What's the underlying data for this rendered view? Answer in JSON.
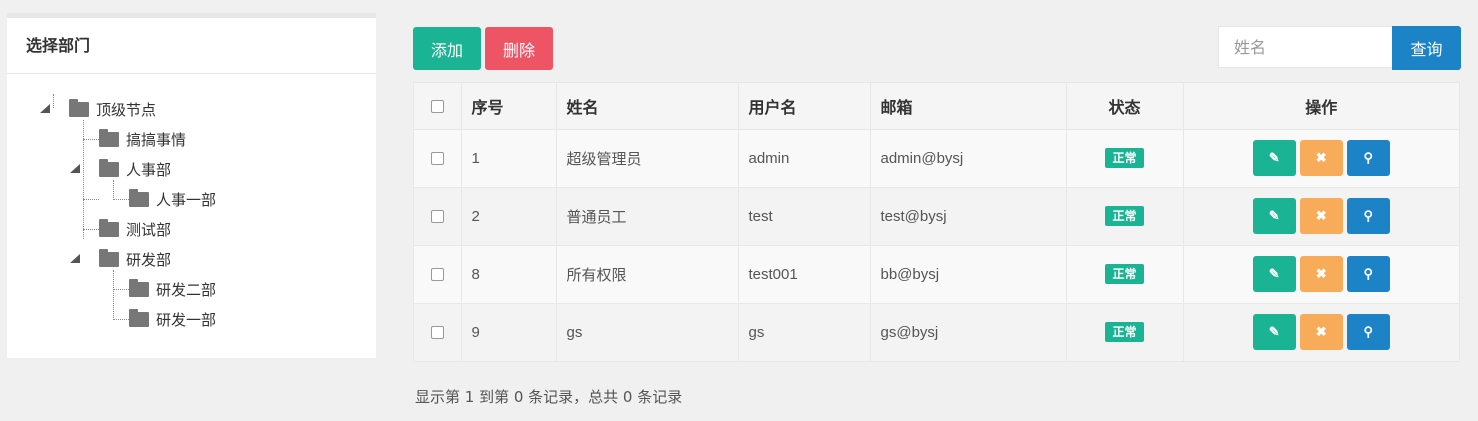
{
  "dept_panel": {
    "title": "选择部门",
    "nodes": [
      {
        "label": "顶级节点",
        "expanded": true
      },
      {
        "label": "搞搞事情"
      },
      {
        "label": "人事部",
        "expanded": true
      },
      {
        "label": "人事一部"
      },
      {
        "label": "测试部"
      },
      {
        "label": "研发部",
        "expanded": true
      },
      {
        "label": "研发二部"
      },
      {
        "label": "研发一部"
      }
    ]
  },
  "toolbar": {
    "add_label": "添加",
    "delete_label": "删除",
    "search_placeholder": "姓名",
    "search_value": "",
    "query_label": "查询"
  },
  "table": {
    "columns": [
      "序号",
      "姓名",
      "用户名",
      "邮箱",
      "状态",
      "操作"
    ],
    "rows": [
      {
        "id": "1",
        "name": "超级管理员",
        "username": "admin",
        "email": "admin@bysj",
        "status": "正常"
      },
      {
        "id": "2",
        "name": "普通员工",
        "username": "test",
        "email": "test@bysj",
        "status": "正常"
      },
      {
        "id": "8",
        "name": "所有权限",
        "username": "test001",
        "email": "bb@bysj",
        "status": "正常"
      },
      {
        "id": "9",
        "name": "gs",
        "username": "gs",
        "email": "gs@bysj",
        "status": "正常"
      }
    ],
    "action_icons": [
      "edit-icon",
      "remove-icon",
      "key-icon"
    ]
  },
  "pagination": {
    "info": "显示第 1 到第 0 条记录，总共 0 条记录"
  },
  "colors": {
    "primary": "#1ab394",
    "danger": "#ed5565",
    "warning": "#f8ac59",
    "info": "#1c84c6"
  }
}
